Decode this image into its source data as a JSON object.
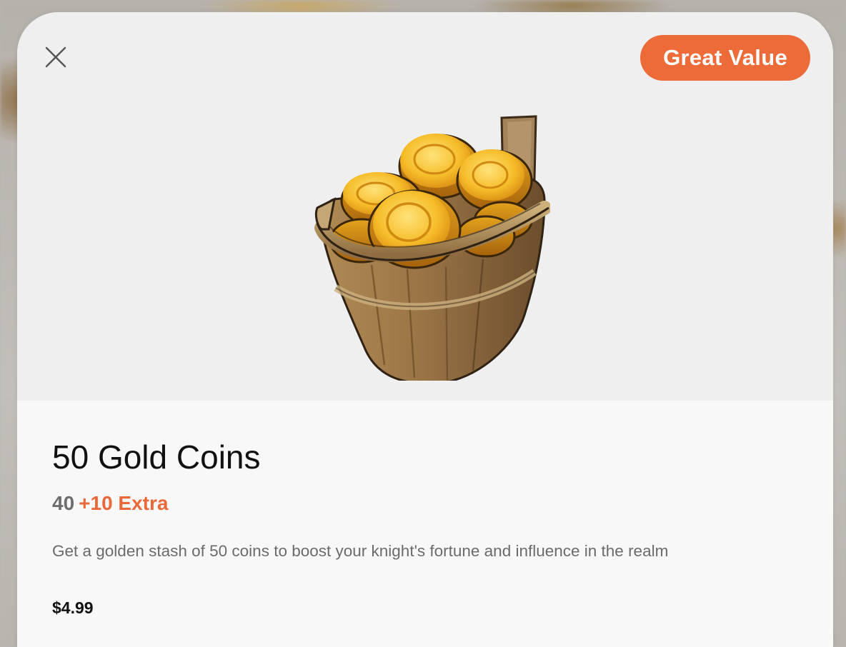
{
  "dialog": {
    "close_label": "Close",
    "badge": "Great Value",
    "accent_color": "#ec6b39",
    "image_icon": "gold-coin-bucket-icon"
  },
  "product": {
    "title": "50 Gold Coins",
    "base_amount": "40",
    "bonus": "+10 Extra",
    "description": "Get a golden stash of 50 coins to boost your knight's fortune and influence in the realm",
    "price": "$4.99"
  }
}
